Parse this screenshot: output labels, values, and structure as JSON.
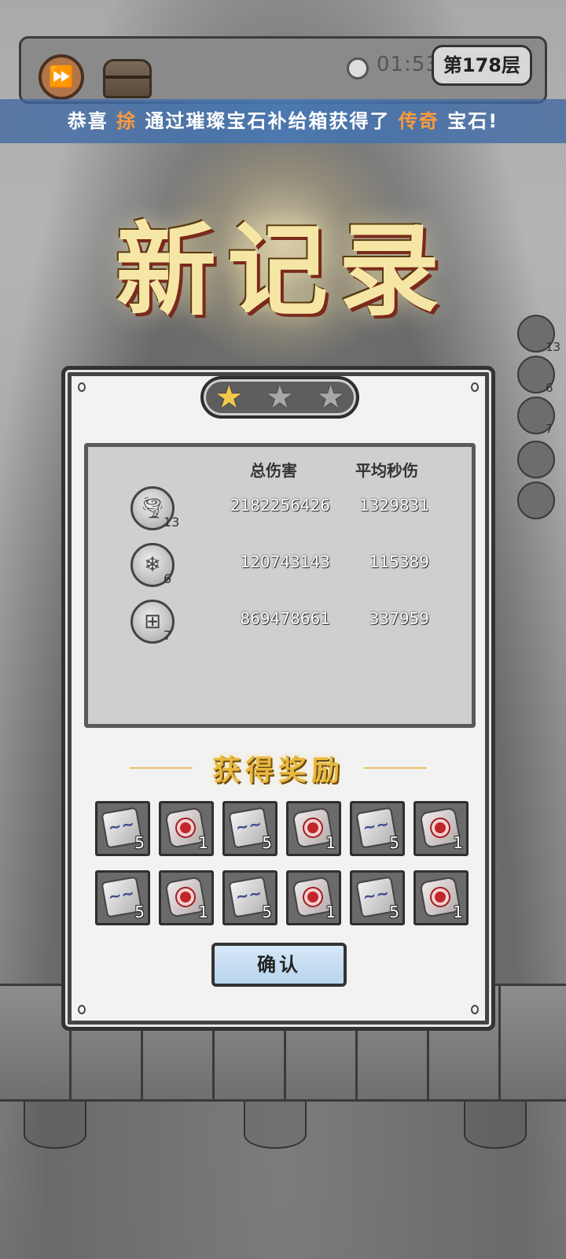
{
  "hud": {
    "timer": "01:53",
    "floor": "第178层"
  },
  "banner": {
    "prefix": "恭喜",
    "player": "捈",
    "middle": "通过璀璨宝石补给箱获得了",
    "rarity": "传奇",
    "suffix": "宝石!"
  },
  "title": "新记录",
  "side_skills": [
    {
      "count": "13"
    },
    {
      "count": "6"
    },
    {
      "count": "7"
    }
  ],
  "result": {
    "stars_earned": 1,
    "stars_total": 3,
    "headers": {
      "total_damage": "总伤害",
      "avg_dps": "平均秒伤"
    },
    "skills": [
      {
        "icon": "tornado-icon",
        "level": "13",
        "total_damage": "2182256426",
        "avg_dps": "1329831"
      },
      {
        "icon": "crystal-burst-icon",
        "level": "6",
        "total_damage": "120743143",
        "avg_dps": "115389"
      },
      {
        "icon": "drill-icon",
        "level": "7",
        "total_damage": "869478661",
        "avg_dps": "337959"
      }
    ],
    "rewards_title": "获得奖励",
    "rewards": [
      {
        "type": "blue-rune-gem-icon",
        "count": "5"
      },
      {
        "type": "red-sun-gem-icon",
        "count": "1"
      },
      {
        "type": "blue-rune-gem-icon",
        "count": "5"
      },
      {
        "type": "red-sun-gem-icon",
        "count": "1"
      },
      {
        "type": "blue-rune-gem-icon",
        "count": "5"
      },
      {
        "type": "red-sun-gem-icon",
        "count": "1"
      },
      {
        "type": "blue-rune-gem-icon",
        "count": "5"
      },
      {
        "type": "red-sun-gem-icon",
        "count": "1"
      },
      {
        "type": "blue-rune-gem-icon",
        "count": "5"
      },
      {
        "type": "red-sun-gem-icon",
        "count": "1"
      },
      {
        "type": "blue-rune-gem-icon",
        "count": "5"
      },
      {
        "type": "red-sun-gem-icon",
        "count": "1"
      }
    ],
    "confirm_label": "确认"
  }
}
